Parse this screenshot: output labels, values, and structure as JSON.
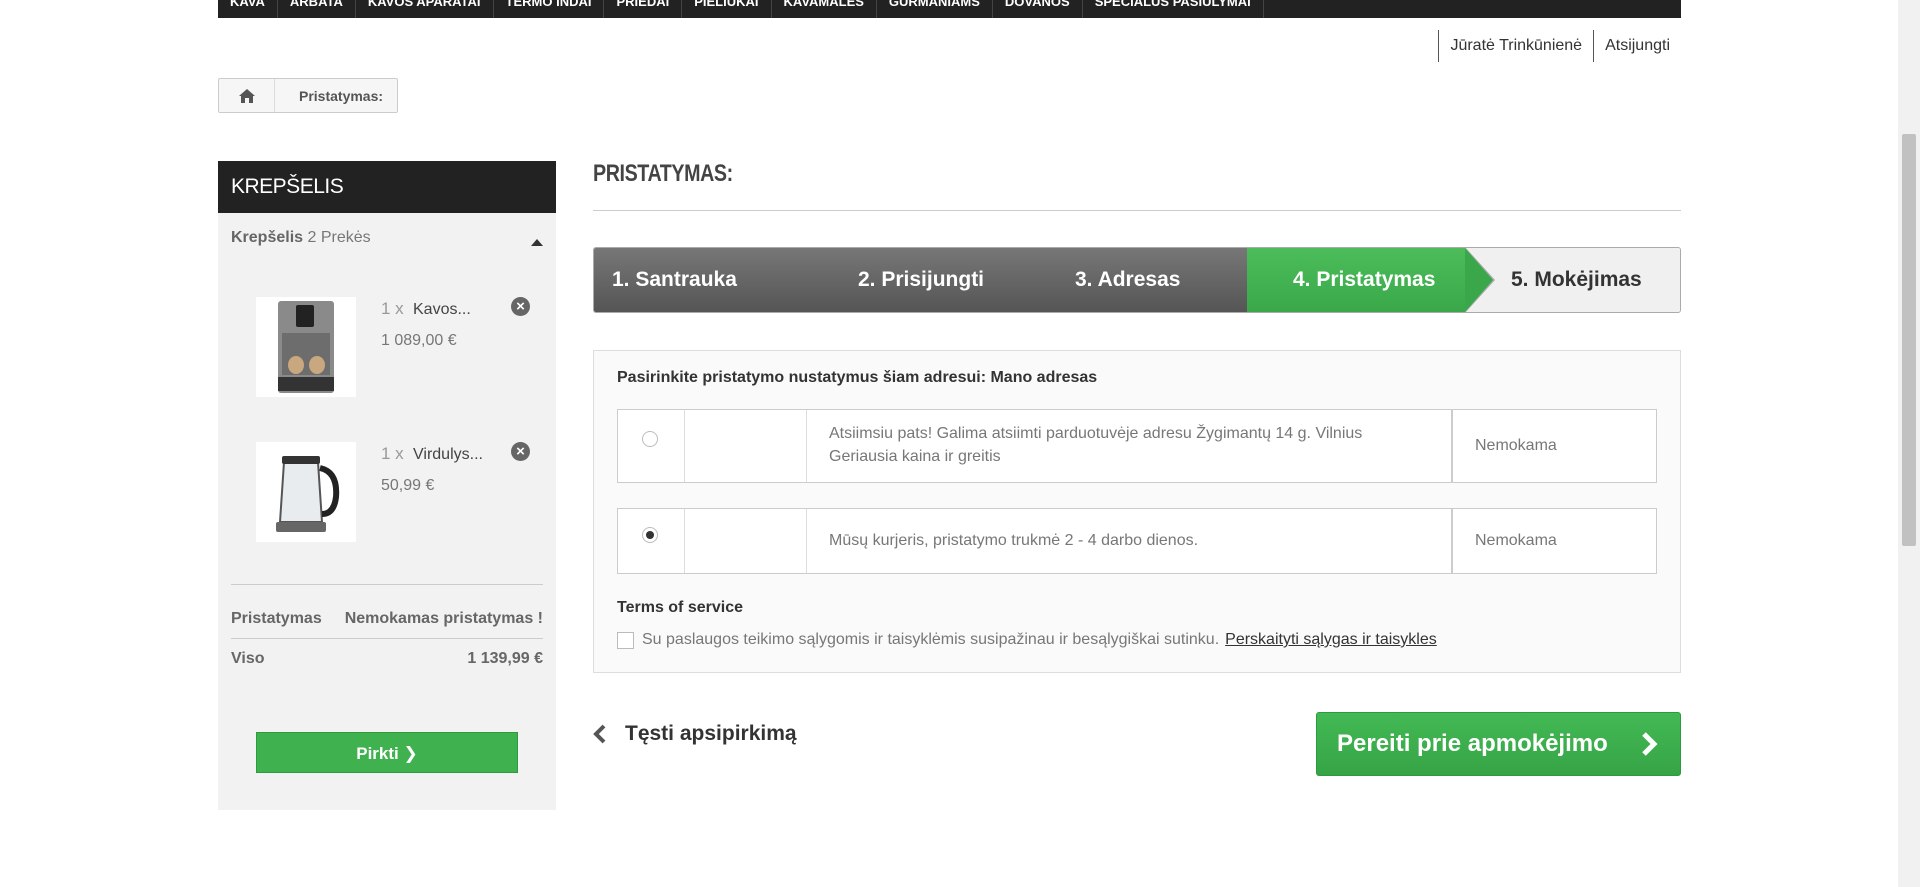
{
  "topnav": {
    "items": [
      "Kava",
      "Arbata",
      "Kavos aparatai",
      "Termo indai",
      "Priedai",
      "Pieliukai",
      "Kavamalės",
      "Gurmaniams",
      "Dovanos",
      "Specialūs pasiūlymai"
    ]
  },
  "userbar": {
    "user_name": "Jūratė Trinkūnienė",
    "logout_label": "Atsijungti"
  },
  "breadcrumb": {
    "current": "Pristatymas:"
  },
  "cart": {
    "header": "KREPŠELIS",
    "summary_label": "Krepšelis",
    "summary_count": "2 Prekės",
    "items": [
      {
        "qty": "1 x",
        "name": "Kavos...",
        "price": "1 089,00 €"
      },
      {
        "qty": "1 x",
        "name": "Virdulys...",
        "price": "50,99 €"
      }
    ],
    "shipping_label": "Pristatymas",
    "shipping_value": "Nemokamas pristatymas !",
    "total_label": "Viso",
    "total_value": "1 139,99 €",
    "buy_button": "Pirkti"
  },
  "main": {
    "title": "PRISTATYMAS:",
    "steps": [
      "1. Santrauka",
      "2. Prisijungti",
      "3. Adresas",
      "4. Pristatymas",
      "5. Mokėjimas"
    ],
    "active_step": 4,
    "shipping_title": "Pasirinkite pristatymo nustatymus šiam adresui: Mano adresas",
    "options": [
      {
        "desc_line1": "Atsiimsiu pats! Galima atsiimti parduotuvėje adresu Žygimantų 14 g. Vilnius",
        "desc_line2": "Geriausia kaina ir greitis",
        "price": "Nemokama",
        "selected": false
      },
      {
        "desc_line1": "Mūsų kurjeris, pristatymo trukmė 2 - 4 darbo dienos.",
        "desc_line2": "",
        "price": "Nemokama",
        "selected": true
      }
    ],
    "tos_title": "Terms of service",
    "tos_text": "Su paslaugos teikimo sąlygomis ir taisyklėmis susipažinau ir besąlygiškai sutinku.",
    "tos_link": "Perskaityti sąlygas ir taisykles",
    "continue_label": "Tęsti apsipirkimą",
    "next_button": "Pereiti prie apmokėjimo"
  },
  "colors": {
    "accent_green": "#3fb14f",
    "dark_header": "#222222",
    "step_gray": "#555555"
  }
}
